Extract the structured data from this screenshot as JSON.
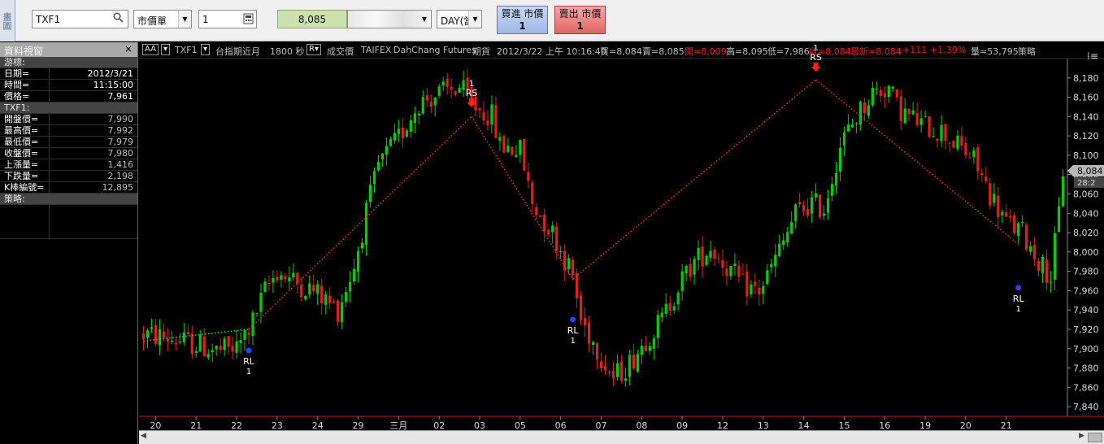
{
  "side_tab": "畫圖",
  "order_bar": {
    "symbol": "TXF1",
    "order_type": "市價單",
    "quantity": "1",
    "price": "8,085",
    "period": "DAY(當",
    "buy_label": "買進 市價",
    "buy_qty": "1",
    "sell_label": "賣出 市價",
    "sell_qty": "1"
  },
  "data_window": {
    "title": "資料視窗",
    "close": "×",
    "cursor_section": "游標:",
    "cursor_rows": [
      {
        "label": "日期=",
        "value": "2012/3/21"
      },
      {
        "label": "時間=",
        "value": "11:15:00"
      },
      {
        "label": "價格=",
        "value": "7,961"
      }
    ],
    "symbol_section": "TXF1:",
    "symbol_rows": [
      {
        "label": "開盤價=",
        "value": "7,990"
      },
      {
        "label": "最高價=",
        "value": "7,992"
      },
      {
        "label": "最低價=",
        "value": "7,979"
      },
      {
        "label": "收盤價=",
        "value": "7,980"
      },
      {
        "label": "上漲量=",
        "value": "1,416"
      },
      {
        "label": "下跌量=",
        "value": "2,198"
      },
      {
        "label": "K棒編號=",
        "value": "12,895"
      }
    ],
    "strategy_section": "策略:"
  },
  "chart_header": {
    "aa": "AA",
    "symbol": "TXF1",
    "name": "台指期近月",
    "interval": "1800 秒",
    "price_type": "成交價",
    "exchange": "TAIFEX",
    "broker": "DahChang Futures",
    "kind": "期貨",
    "datetime": "2012/3/22 上午 10:16:40",
    "bid": "買=8,084",
    "ask": "賣=8,085",
    "open": "開=8,009",
    "high": "高=8,095",
    "low": "低=7,986",
    "close": "收=8,084",
    "last": "最新=8,084",
    "change": "+111",
    "pct": "+1.39%",
    "volume": "量=53,795",
    "strategy": "策略"
  },
  "chart_data": {
    "type": "candlestick",
    "ylim": [
      7830,
      8200
    ],
    "y_ticks": [
      7840,
      7860,
      7880,
      7900,
      7920,
      7940,
      7960,
      7980,
      8000,
      8020,
      8040,
      8060,
      8080,
      8100,
      8120,
      8140,
      8160,
      8180
    ],
    "y_tick_labels": [
      "7,840",
      "7,860",
      "7,880",
      "7,900",
      "7,920",
      "7,940",
      "7,960",
      "7,980",
      "8,000",
      "8,020",
      "8,040",
      "8,060",
      "8,080",
      "8,100",
      "8,120",
      "8,140",
      "8,160",
      "8,180"
    ],
    "x_labels": [
      "20",
      "21",
      "22",
      "23",
      "24",
      "29",
      "三月",
      "02",
      "03",
      "05",
      "06",
      "07",
      "08",
      "09",
      "12",
      "13",
      "14",
      "15",
      "16",
      "19",
      "20",
      "21"
    ],
    "x_label_at": [
      0,
      10,
      20,
      30,
      40,
      50,
      60,
      70,
      80,
      90,
      100,
      110,
      120,
      130,
      140,
      150,
      160,
      170,
      180,
      190,
      200,
      210
    ],
    "n_bars": 228,
    "last_price": "8,084",
    "countdown": "28:2",
    "up_color": "#00d000",
    "down_color": "#e02020",
    "anchors": [
      [
        0,
        7915
      ],
      [
        5,
        7912
      ],
      [
        12,
        7905
      ],
      [
        18,
        7898
      ],
      [
        23,
        7900
      ],
      [
        27,
        7928
      ],
      [
        30,
        7960
      ],
      [
        33,
        7980
      ],
      [
        37,
        7970
      ],
      [
        42,
        7960
      ],
      [
        48,
        7940
      ],
      [
        52,
        7985
      ],
      [
        55,
        8040
      ],
      [
        58,
        8090
      ],
      [
        63,
        8118
      ],
      [
        68,
        8155
      ],
      [
        74,
        8165
      ],
      [
        78,
        8170
      ],
      [
        82,
        8150
      ],
      [
        86,
        8140
      ],
      [
        88,
        8110
      ],
      [
        93,
        8105
      ],
      [
        96,
        8050
      ],
      [
        101,
        8020
      ],
      [
        106,
        7975
      ],
      [
        108,
        7930
      ],
      [
        112,
        7900
      ],
      [
        116,
        7870
      ],
      [
        120,
        7885
      ],
      [
        124,
        7910
      ],
      [
        128,
        7930
      ],
      [
        132,
        7965
      ],
      [
        136,
        7990
      ],
      [
        140,
        8005
      ],
      [
        144,
        7985
      ],
      [
        148,
        7965
      ],
      [
        152,
        7960
      ],
      [
        154,
        7975
      ],
      [
        158,
        8010
      ],
      [
        161,
        8040
      ],
      [
        165,
        8050
      ],
      [
        168,
        8045
      ],
      [
        172,
        8110
      ],
      [
        176,
        8140
      ],
      [
        180,
        8165
      ],
      [
        184,
        8170
      ],
      [
        186,
        8150
      ],
      [
        189,
        8140
      ],
      [
        193,
        8130
      ],
      [
        197,
        8125
      ],
      [
        201,
        8110
      ],
      [
        205,
        8095
      ],
      [
        209,
        8060
      ],
      [
        213,
        8030
      ],
      [
        217,
        8020
      ],
      [
        219,
        8005
      ],
      [
        222,
        7985
      ],
      [
        224,
        7975
      ],
      [
        226,
        8040
      ],
      [
        227,
        8084
      ]
    ],
    "zigzag": [
      [
        0,
        7908
      ],
      [
        26,
        7920
      ],
      [
        81,
        8140
      ],
      [
        106,
        7972
      ],
      [
        166,
        8178
      ],
      [
        216,
        8008
      ]
    ],
    "signals": [
      {
        "type": "RL",
        "count": "1",
        "bar": 26,
        "price": 7898,
        "label_side": "below"
      },
      {
        "type": "RS",
        "count": "1",
        "bar": 81,
        "price": 8148,
        "label_side": "above"
      },
      {
        "type": "RL",
        "count": "1",
        "bar": 106,
        "price": 7930,
        "label_side": "below"
      },
      {
        "type": "RS",
        "count": "1",
        "bar": 166,
        "price": 8185,
        "label_side": "above"
      },
      {
        "type": "RL",
        "count": "1",
        "bar": 216,
        "price": 7963,
        "label_side": "below"
      }
    ]
  }
}
